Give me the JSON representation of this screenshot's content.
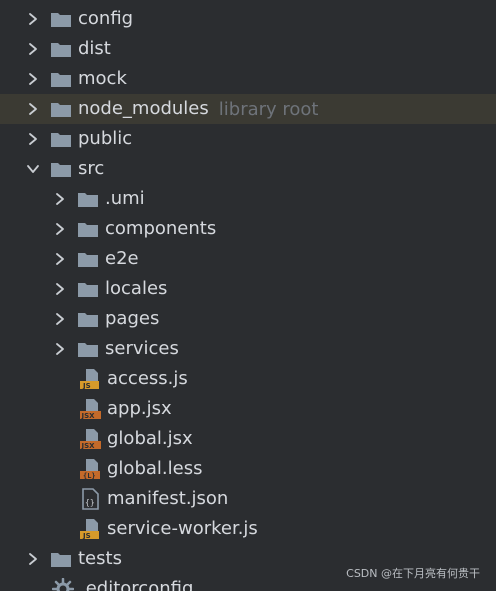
{
  "tree": {
    "folders_level0_top": [
      {
        "label": "config"
      },
      {
        "label": "dist"
      },
      {
        "label": "mock"
      },
      {
        "label": "node_modules",
        "hint": "library root"
      },
      {
        "label": "public"
      },
      {
        "label": "src"
      }
    ],
    "src_children_folders": [
      {
        "label": ".umi"
      },
      {
        "label": "components"
      },
      {
        "label": "e2e"
      },
      {
        "label": "locales"
      },
      {
        "label": "pages"
      },
      {
        "label": "services"
      }
    ],
    "src_children_files": [
      {
        "label": "access.js",
        "badge": "JS"
      },
      {
        "label": "app.jsx",
        "badge": "JSX"
      },
      {
        "label": "global.jsx",
        "badge": "JSX"
      },
      {
        "label": "global.less",
        "badge": "{L}"
      },
      {
        "label": "manifest.json",
        "badge": "{}"
      },
      {
        "label": "service-worker.js",
        "badge": "JS"
      }
    ],
    "folders_level0_bottom": [
      {
        "label": "tests"
      }
    ],
    "partial_bottom_item": {
      "label": ".editorconfig"
    }
  },
  "watermark": "CSDN @在下月亮有何贵干",
  "colors": {
    "background": "#2b2d30",
    "highlight_row": "#3b3a33",
    "folder_icon": "#8c9aa8",
    "text": "#d6d9de",
    "hint_text": "#6e737a",
    "js_badge": "#d69a2b",
    "jsx_badge": "#c46a2a",
    "less_badge": "#c46a2a"
  }
}
